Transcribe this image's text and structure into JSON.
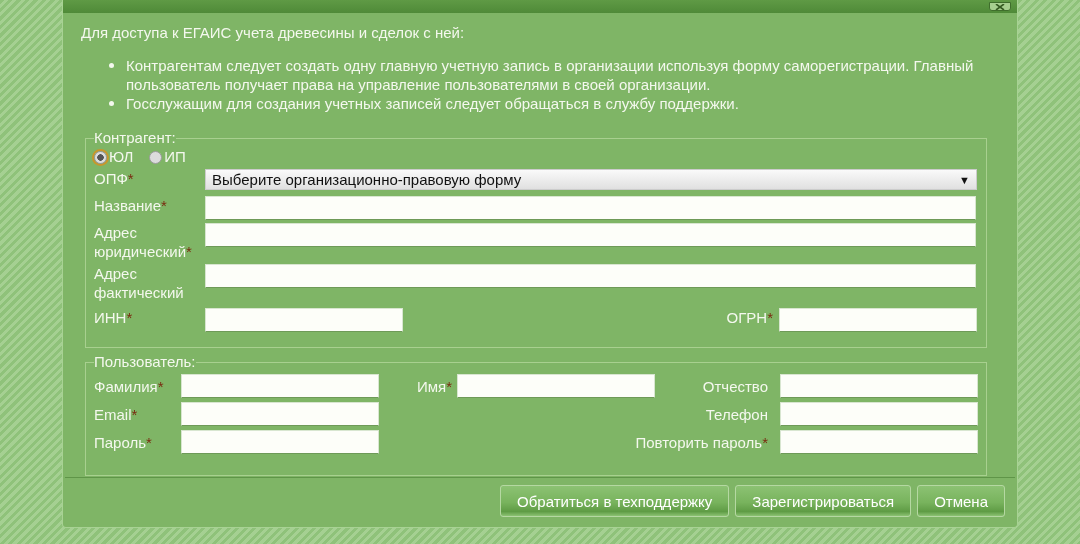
{
  "intro": "Для доступа к ЕГАИС учета древесины и сделок с ней:",
  "bullets": [
    "Контрагентам следует создать одну главную учетную запись в организации используя форму саморегистрации. Главный пользователь получает права на управление пользователями в своей организации.",
    "Госслужащим для создания учетных записей следует обращаться в службу поддержки."
  ],
  "counterparty": {
    "legend": "Контрагент:",
    "types": [
      {
        "label": "ЮЛ",
        "selected": true
      },
      {
        "label": "ИП",
        "selected": false
      }
    ],
    "fields": [
      {
        "kind": "select",
        "label": "ОПФ",
        "mark": "*",
        "value": "Выберите организационно-правовую форму",
        "arrow": "▼"
      },
      {
        "kind": "text",
        "label": "Название",
        "mark": "*"
      },
      {
        "kind": "text",
        "label": "Адрес юридический",
        "mark": "*"
      },
      {
        "kind": "text",
        "label": "Адрес фактический"
      },
      {
        "kind": "pair",
        "label": "ИНН",
        "mark": "*",
        "label_2": "ОГРН",
        "mark_2": "*"
      }
    ]
  },
  "user": {
    "legend": "Пользователь:",
    "rows": [
      [
        {
          "kind": "left",
          "label": "Фамилия",
          "mark": "*"
        },
        {
          "kind": "middle",
          "label": "Имя",
          "mark": "*"
        },
        {
          "kind": "right",
          "label": "Отчество"
        }
      ],
      [
        {
          "kind": "left",
          "label": "Email",
          "mark": "*"
        },
        {
          "kind": "right",
          "label": "Телефон"
        }
      ],
      [
        {
          "kind": "left",
          "label": "Пароль",
          "mark": "*"
        },
        {
          "kind": "right",
          "label": "Повторить пароль",
          "mark": "*"
        }
      ]
    ]
  },
  "buttons": [
    "Обратиться в техподдержку",
    "Зарегистрироваться",
    "Отмена"
  ]
}
